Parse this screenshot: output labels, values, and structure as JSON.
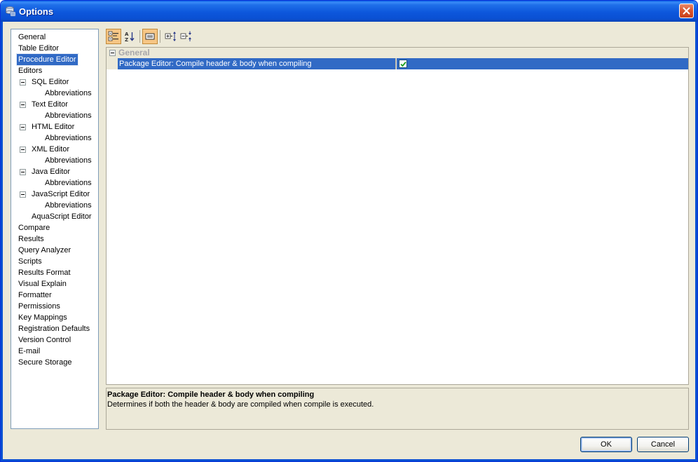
{
  "window": {
    "title": "Options",
    "title_icon": "database-stack-icon",
    "close_icon": "close-icon"
  },
  "nav": {
    "items": [
      {
        "label": "General",
        "level": 0
      },
      {
        "label": "Table Editor",
        "level": 0
      },
      {
        "label": "Procedure Editor",
        "level": 0,
        "selected": true
      },
      {
        "label": "Editors",
        "level": 0
      },
      {
        "label": "SQL Editor",
        "level": 1,
        "expanded": true
      },
      {
        "label": "Abbreviations",
        "level": 2
      },
      {
        "label": "Text Editor",
        "level": 1,
        "expanded": true
      },
      {
        "label": "Abbreviations",
        "level": 2
      },
      {
        "label": "HTML Editor",
        "level": 1,
        "expanded": true
      },
      {
        "label": "Abbreviations",
        "level": 2
      },
      {
        "label": "XML Editor",
        "level": 1,
        "expanded": true
      },
      {
        "label": "Abbreviations",
        "level": 2
      },
      {
        "label": "Java Editor",
        "level": 1,
        "expanded": true
      },
      {
        "label": "Abbreviations",
        "level": 2
      },
      {
        "label": "JavaScript Editor",
        "level": 1,
        "expanded": true
      },
      {
        "label": "Abbreviations",
        "level": 2
      },
      {
        "label": "AquaScript Editor",
        "level": 1
      },
      {
        "label": "Compare",
        "level": 0
      },
      {
        "label": "Results",
        "level": 0
      },
      {
        "label": "Query Analyzer",
        "level": 0
      },
      {
        "label": "Scripts",
        "level": 0
      },
      {
        "label": "Results Format",
        "level": 0
      },
      {
        "label": "Visual Explain",
        "level": 0
      },
      {
        "label": "Formatter",
        "level": 0
      },
      {
        "label": "Permissions",
        "level": 0
      },
      {
        "label": "Key Mappings",
        "level": 0
      },
      {
        "label": "Registration Defaults",
        "level": 0
      },
      {
        "label": "Version Control",
        "level": 0
      },
      {
        "label": "E-mail",
        "level": 0
      },
      {
        "label": "Secure Storage",
        "level": 0
      }
    ]
  },
  "toolbar": {
    "buttons": [
      {
        "icon": "categorized-view-icon",
        "active": true
      },
      {
        "icon": "sort-alphabetical-icon",
        "active": false
      },
      {
        "icon": "property-pages-icon",
        "active": true
      },
      {
        "icon": "expand-all-icon",
        "active": false
      },
      {
        "icon": "collapse-all-icon",
        "active": false
      }
    ]
  },
  "properties": {
    "category": "General",
    "rows": [
      {
        "name": "Package Editor: Compile header & body when compiling",
        "checked": true
      }
    ]
  },
  "help": {
    "title": "Package Editor: Compile header & body when compiling",
    "description": "Determines if both the header & body are compiled when compile is executed."
  },
  "buttons": {
    "ok": "OK",
    "cancel": "Cancel"
  },
  "colors": {
    "selection": "#316ac5",
    "titlebar": "#0a50d3",
    "dialog_bg": "#ece9d8"
  }
}
